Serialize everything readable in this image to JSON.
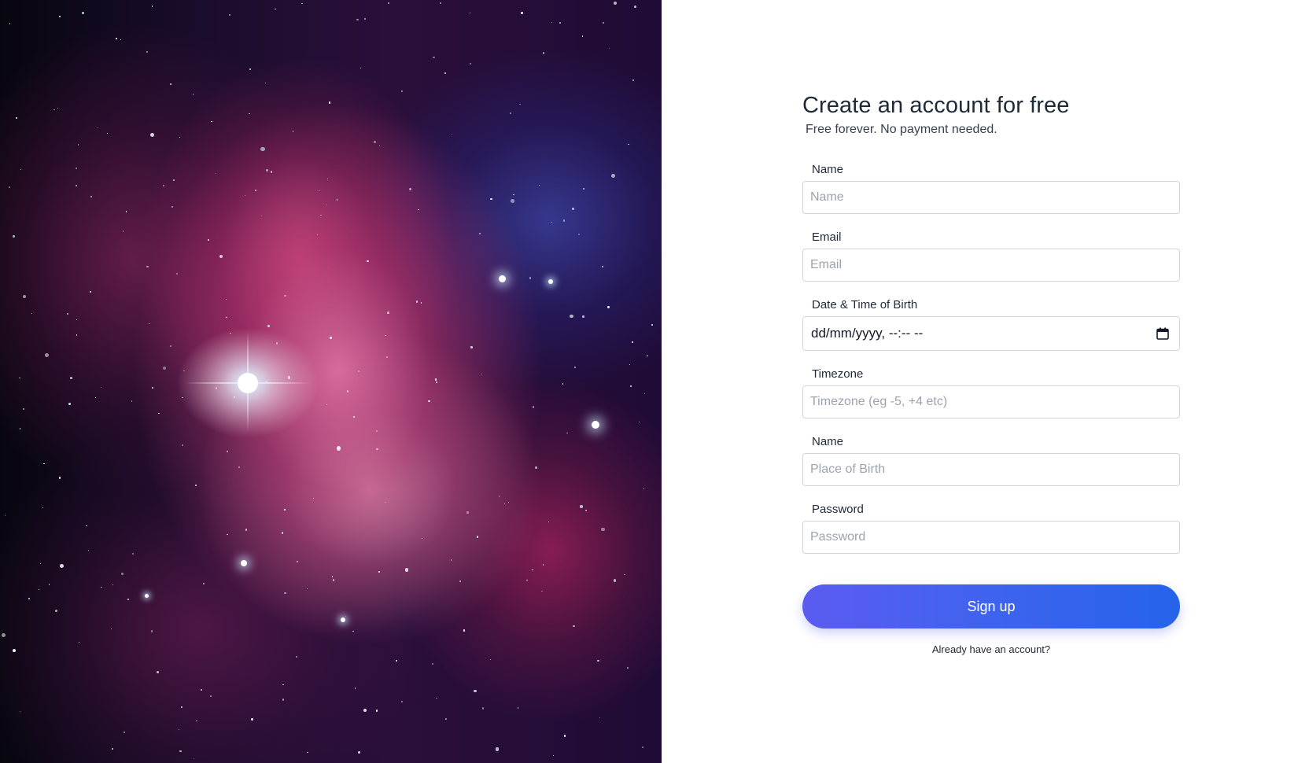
{
  "form": {
    "title": "Create an account for free",
    "subtitle": "Free forever. No payment needed.",
    "fields": [
      {
        "label": "Name",
        "placeholder": "Name"
      },
      {
        "label": "Email",
        "placeholder": "Email"
      },
      {
        "label": "Date & Time of Birth",
        "value": "dd/mm/yyyy, --:-- --"
      },
      {
        "label": "Timezone",
        "placeholder": "Timezone (eg -5, +4 etc)"
      },
      {
        "label": "Name",
        "placeholder": "Place of Birth"
      },
      {
        "label": "Password",
        "placeholder": "Password"
      }
    ],
    "submit_label": "Sign up",
    "login_link": "Already have an account?"
  },
  "icons": {
    "calendar": "calendar-icon"
  },
  "colors": {
    "button_start": "#5b5cf0",
    "button_end": "#2563eb",
    "title": "#1f2a37",
    "input_border": "#d1d5db"
  }
}
